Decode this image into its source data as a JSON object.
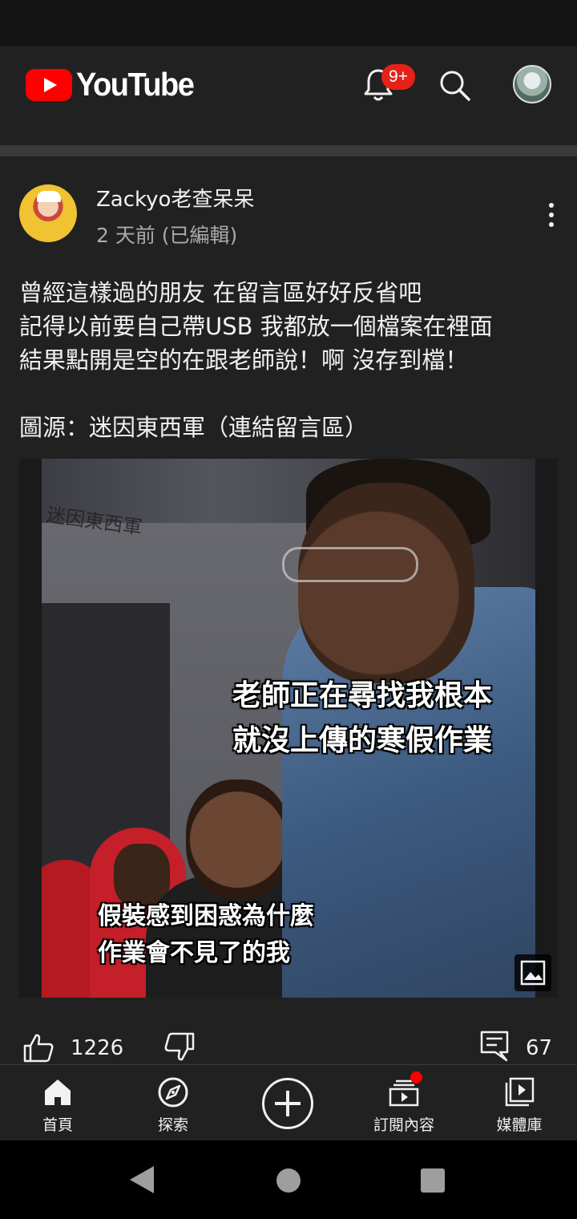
{
  "header": {
    "logo_text": "YouTube",
    "notification_badge": "9+"
  },
  "post": {
    "author": "Zackyo老查呆呆",
    "time": "2 天前 (已編輯)",
    "text": "曾經這樣過的朋友 在留言區好好反省吧\n記得以前要自己帶USB 我都放一個檔案在裡面\n結果點開是空的在跟老師說！啊 沒存到檔！\n\n圖源：迷因東西軍（連結留言區）",
    "image": {
      "watermark": "迷因東西軍",
      "caption_top": "老師正在尋找我根本\n就沒上傳的寒假作業",
      "caption_bottom": "假裝感到困惑為什麼\n作業會不見了的我"
    },
    "likes": "1226",
    "comments": "67"
  },
  "bottom_nav": {
    "items": [
      {
        "label": "首頁",
        "icon": "home-icon"
      },
      {
        "label": "探索",
        "icon": "explore-icon"
      },
      {
        "label": "",
        "icon": "create-icon"
      },
      {
        "label": "訂閱內容",
        "icon": "subscriptions-icon"
      },
      {
        "label": "媒體庫",
        "icon": "library-icon"
      }
    ]
  },
  "colors": {
    "background": "#212121",
    "brand_red": "#ff0000",
    "badge_red": "#e62117",
    "text_primary": "#f1f1f1",
    "text_secondary": "#aaaaaa"
  }
}
